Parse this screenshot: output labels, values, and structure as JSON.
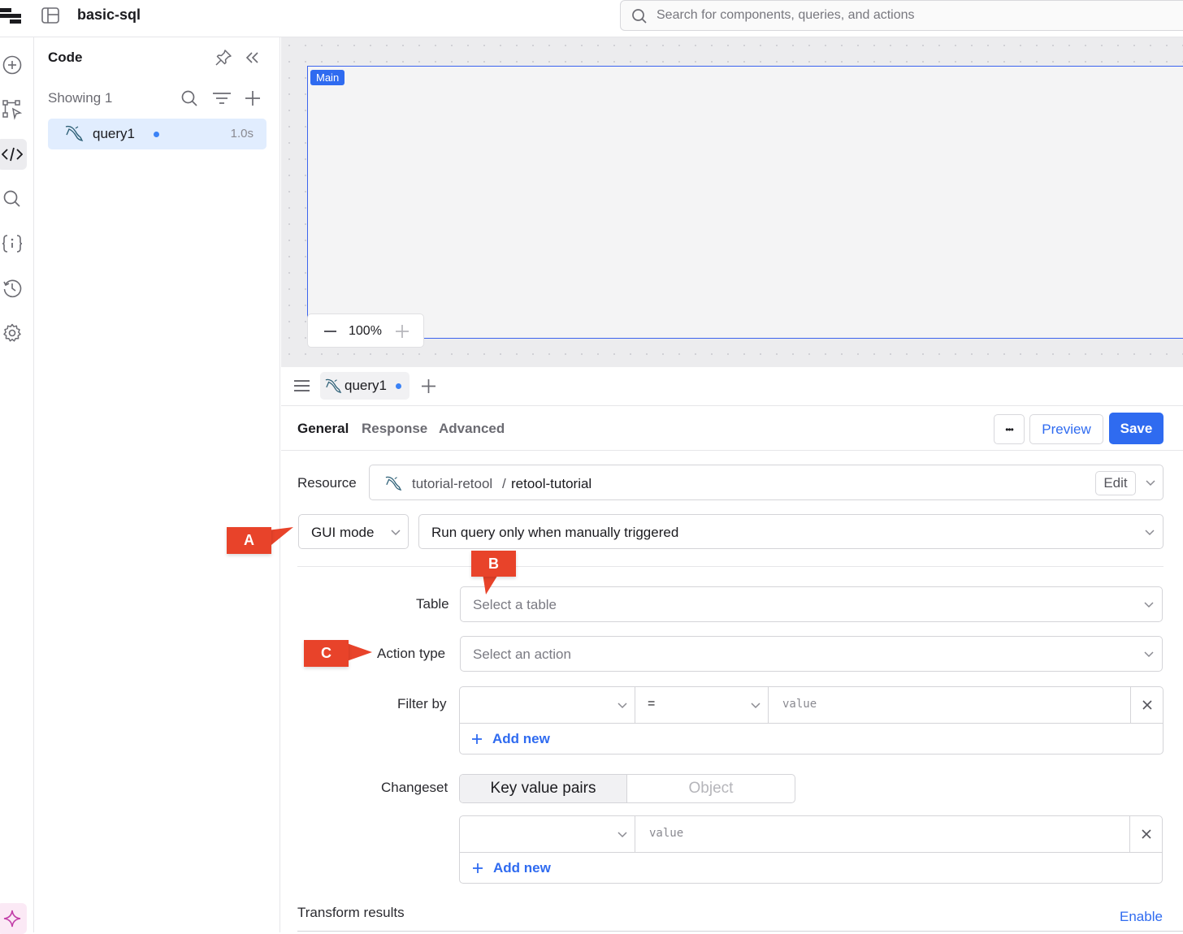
{
  "app": {
    "title": "basic-sql"
  },
  "search": {
    "placeholder": "Search for components, queries, and actions"
  },
  "rail": {
    "icons": [
      "add-icon",
      "workflow-icon",
      "code-icon",
      "search-icon",
      "variables-icon",
      "history-icon",
      "settings-icon",
      "ai-sparkle-icon"
    ]
  },
  "code_panel": {
    "title": "Code",
    "showing": "Showing 1",
    "query": {
      "name": "query1",
      "time": "1.0s"
    }
  },
  "canvas": {
    "frame_label": "Main",
    "zoom": "100%"
  },
  "editor": {
    "tab_name": "query1",
    "subtabs": [
      "General",
      "Response",
      "Advanced"
    ],
    "more_label": "•••",
    "preview_label": "Preview",
    "save_label": "Save",
    "resource": {
      "label": "Resource",
      "name": "tutorial-retool",
      "separator": "/",
      "database": "retool-tutorial",
      "edit_label": "Edit"
    },
    "mode": "GUI mode",
    "trigger": "Run query only when manually triggered",
    "table": {
      "label": "Table",
      "placeholder": "Select a table"
    },
    "action_type": {
      "label": "Action type",
      "placeholder": "Select an action"
    },
    "filter_by": {
      "label": "Filter by",
      "operator": "=",
      "value_placeholder": "value",
      "add_new": "Add new"
    },
    "changeset": {
      "label": "Changeset",
      "options": [
        "Key value pairs",
        "Object"
      ],
      "value_placeholder": "value",
      "add_new": "Add new"
    },
    "transform": {
      "label": "Transform results",
      "enable_label": "Enable"
    }
  },
  "callouts": {
    "a": "A",
    "b": "B",
    "c": "C"
  },
  "colors": {
    "accent": "#2f6bf0",
    "callout": "#e8432a",
    "selected_bg": "#e1edfe"
  }
}
